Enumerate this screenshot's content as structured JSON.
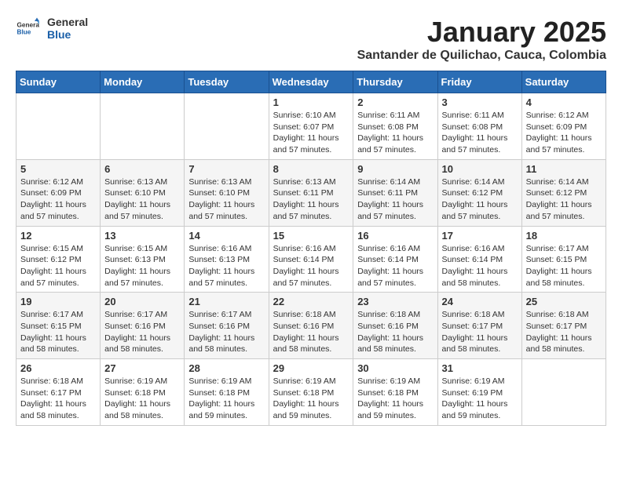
{
  "header": {
    "logo": {
      "general": "General",
      "blue": "Blue"
    },
    "title": "January 2025",
    "subtitle": "Santander de Quilichao, Cauca, Colombia"
  },
  "weekdays": [
    "Sunday",
    "Monday",
    "Tuesday",
    "Wednesday",
    "Thursday",
    "Friday",
    "Saturday"
  ],
  "weeks": [
    [
      {
        "day": "",
        "info": ""
      },
      {
        "day": "",
        "info": ""
      },
      {
        "day": "",
        "info": ""
      },
      {
        "day": "1",
        "info": "Sunrise: 6:10 AM\nSunset: 6:07 PM\nDaylight: 11 hours and 57 minutes."
      },
      {
        "day": "2",
        "info": "Sunrise: 6:11 AM\nSunset: 6:08 PM\nDaylight: 11 hours and 57 minutes."
      },
      {
        "day": "3",
        "info": "Sunrise: 6:11 AM\nSunset: 6:08 PM\nDaylight: 11 hours and 57 minutes."
      },
      {
        "day": "4",
        "info": "Sunrise: 6:12 AM\nSunset: 6:09 PM\nDaylight: 11 hours and 57 minutes."
      }
    ],
    [
      {
        "day": "5",
        "info": "Sunrise: 6:12 AM\nSunset: 6:09 PM\nDaylight: 11 hours and 57 minutes."
      },
      {
        "day": "6",
        "info": "Sunrise: 6:13 AM\nSunset: 6:10 PM\nDaylight: 11 hours and 57 minutes."
      },
      {
        "day": "7",
        "info": "Sunrise: 6:13 AM\nSunset: 6:10 PM\nDaylight: 11 hours and 57 minutes."
      },
      {
        "day": "8",
        "info": "Sunrise: 6:13 AM\nSunset: 6:11 PM\nDaylight: 11 hours and 57 minutes."
      },
      {
        "day": "9",
        "info": "Sunrise: 6:14 AM\nSunset: 6:11 PM\nDaylight: 11 hours and 57 minutes."
      },
      {
        "day": "10",
        "info": "Sunrise: 6:14 AM\nSunset: 6:12 PM\nDaylight: 11 hours and 57 minutes."
      },
      {
        "day": "11",
        "info": "Sunrise: 6:14 AM\nSunset: 6:12 PM\nDaylight: 11 hours and 57 minutes."
      }
    ],
    [
      {
        "day": "12",
        "info": "Sunrise: 6:15 AM\nSunset: 6:12 PM\nDaylight: 11 hours and 57 minutes."
      },
      {
        "day": "13",
        "info": "Sunrise: 6:15 AM\nSunset: 6:13 PM\nDaylight: 11 hours and 57 minutes."
      },
      {
        "day": "14",
        "info": "Sunrise: 6:16 AM\nSunset: 6:13 PM\nDaylight: 11 hours and 57 minutes."
      },
      {
        "day": "15",
        "info": "Sunrise: 6:16 AM\nSunset: 6:14 PM\nDaylight: 11 hours and 57 minutes."
      },
      {
        "day": "16",
        "info": "Sunrise: 6:16 AM\nSunset: 6:14 PM\nDaylight: 11 hours and 57 minutes."
      },
      {
        "day": "17",
        "info": "Sunrise: 6:16 AM\nSunset: 6:14 PM\nDaylight: 11 hours and 58 minutes."
      },
      {
        "day": "18",
        "info": "Sunrise: 6:17 AM\nSunset: 6:15 PM\nDaylight: 11 hours and 58 minutes."
      }
    ],
    [
      {
        "day": "19",
        "info": "Sunrise: 6:17 AM\nSunset: 6:15 PM\nDaylight: 11 hours and 58 minutes."
      },
      {
        "day": "20",
        "info": "Sunrise: 6:17 AM\nSunset: 6:16 PM\nDaylight: 11 hours and 58 minutes."
      },
      {
        "day": "21",
        "info": "Sunrise: 6:17 AM\nSunset: 6:16 PM\nDaylight: 11 hours and 58 minutes."
      },
      {
        "day": "22",
        "info": "Sunrise: 6:18 AM\nSunset: 6:16 PM\nDaylight: 11 hours and 58 minutes."
      },
      {
        "day": "23",
        "info": "Sunrise: 6:18 AM\nSunset: 6:16 PM\nDaylight: 11 hours and 58 minutes."
      },
      {
        "day": "24",
        "info": "Sunrise: 6:18 AM\nSunset: 6:17 PM\nDaylight: 11 hours and 58 minutes."
      },
      {
        "day": "25",
        "info": "Sunrise: 6:18 AM\nSunset: 6:17 PM\nDaylight: 11 hours and 58 minutes."
      }
    ],
    [
      {
        "day": "26",
        "info": "Sunrise: 6:18 AM\nSunset: 6:17 PM\nDaylight: 11 hours and 58 minutes."
      },
      {
        "day": "27",
        "info": "Sunrise: 6:19 AM\nSunset: 6:18 PM\nDaylight: 11 hours and 58 minutes."
      },
      {
        "day": "28",
        "info": "Sunrise: 6:19 AM\nSunset: 6:18 PM\nDaylight: 11 hours and 59 minutes."
      },
      {
        "day": "29",
        "info": "Sunrise: 6:19 AM\nSunset: 6:18 PM\nDaylight: 11 hours and 59 minutes."
      },
      {
        "day": "30",
        "info": "Sunrise: 6:19 AM\nSunset: 6:18 PM\nDaylight: 11 hours and 59 minutes."
      },
      {
        "day": "31",
        "info": "Sunrise: 6:19 AM\nSunset: 6:19 PM\nDaylight: 11 hours and 59 minutes."
      },
      {
        "day": "",
        "info": ""
      }
    ]
  ]
}
